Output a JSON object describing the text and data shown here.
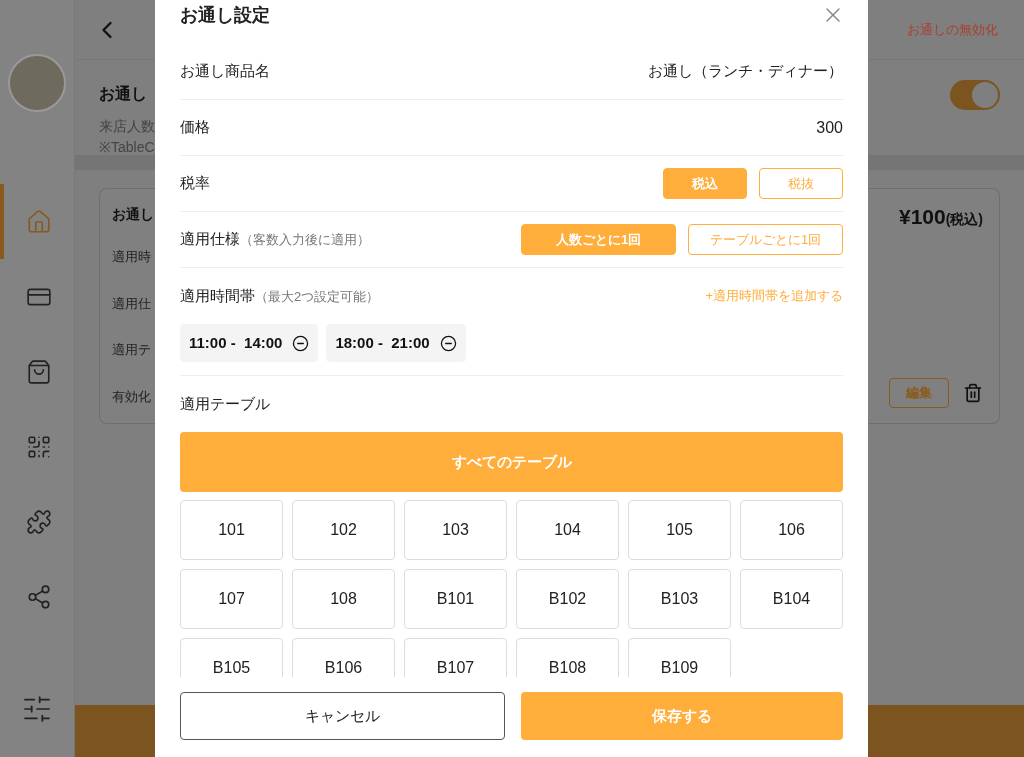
{
  "sidebar": {
    "items": [
      {
        "kind": "home",
        "selected": true
      },
      {
        "kind": "card",
        "selected": false
      },
      {
        "kind": "bag",
        "selected": false
      },
      {
        "kind": "qr",
        "selected": false
      },
      {
        "kind": "puzzle",
        "selected": false
      },
      {
        "kind": "network",
        "selected": false
      }
    ]
  },
  "background": {
    "header": {
      "disable_link": "お通しの無効化"
    },
    "section": {
      "title": "お通し",
      "desc": "来店人数",
      "note": "※TableC",
      "toggle_on": true
    },
    "card": {
      "title": "お通し",
      "rows": [
        "適用時",
        "適用仕",
        "適用テ",
        "有効化"
      ],
      "price": "¥100",
      "price_suffix": "(税込)",
      "edit": "編集"
    }
  },
  "modal": {
    "title": "お通し設定",
    "name": {
      "label": "お通し商品名",
      "value": "お通し（ランチ・ディナー）"
    },
    "price": {
      "label": "価格",
      "value": "300"
    },
    "tax": {
      "label": "税率",
      "options": [
        {
          "label": "税込",
          "selected": true
        },
        {
          "label": "税抜",
          "selected": false
        }
      ]
    },
    "spec": {
      "label": "適用仕様",
      "note": "（客数入力後に適用）",
      "options": [
        {
          "label": "人数ごとに1回",
          "selected": true
        },
        {
          "label": "テーブルごとに1回",
          "selected": false
        }
      ]
    },
    "time": {
      "label": "適用時間帯",
      "note": "（最大2つ設定可能）",
      "add_link": "+適用時間帯を追加する",
      "slots": [
        "11:00 -  14:00",
        "18:00 -  21:00"
      ]
    },
    "tables": {
      "label": "適用テーブル",
      "all": {
        "label": "すべてのテーブル",
        "selected": true
      },
      "items": [
        {
          "label": "101",
          "selected": false
        },
        {
          "label": "102",
          "selected": false
        },
        {
          "label": "103",
          "selected": false
        },
        {
          "label": "104",
          "selected": false
        },
        {
          "label": "105",
          "selected": false
        },
        {
          "label": "106",
          "selected": false
        },
        {
          "label": "107",
          "selected": false
        },
        {
          "label": "108",
          "selected": false
        },
        {
          "label": "B101",
          "selected": false
        },
        {
          "label": "B102",
          "selected": false
        },
        {
          "label": "B103",
          "selected": false
        },
        {
          "label": "B104",
          "selected": false
        },
        {
          "label": "B105",
          "selected": false
        },
        {
          "label": "B106",
          "selected": false
        },
        {
          "label": "B107",
          "selected": false
        },
        {
          "label": "B108",
          "selected": false
        },
        {
          "label": "B109",
          "selected": false
        }
      ]
    },
    "cancel": "キャンセル",
    "save": "保存する"
  }
}
